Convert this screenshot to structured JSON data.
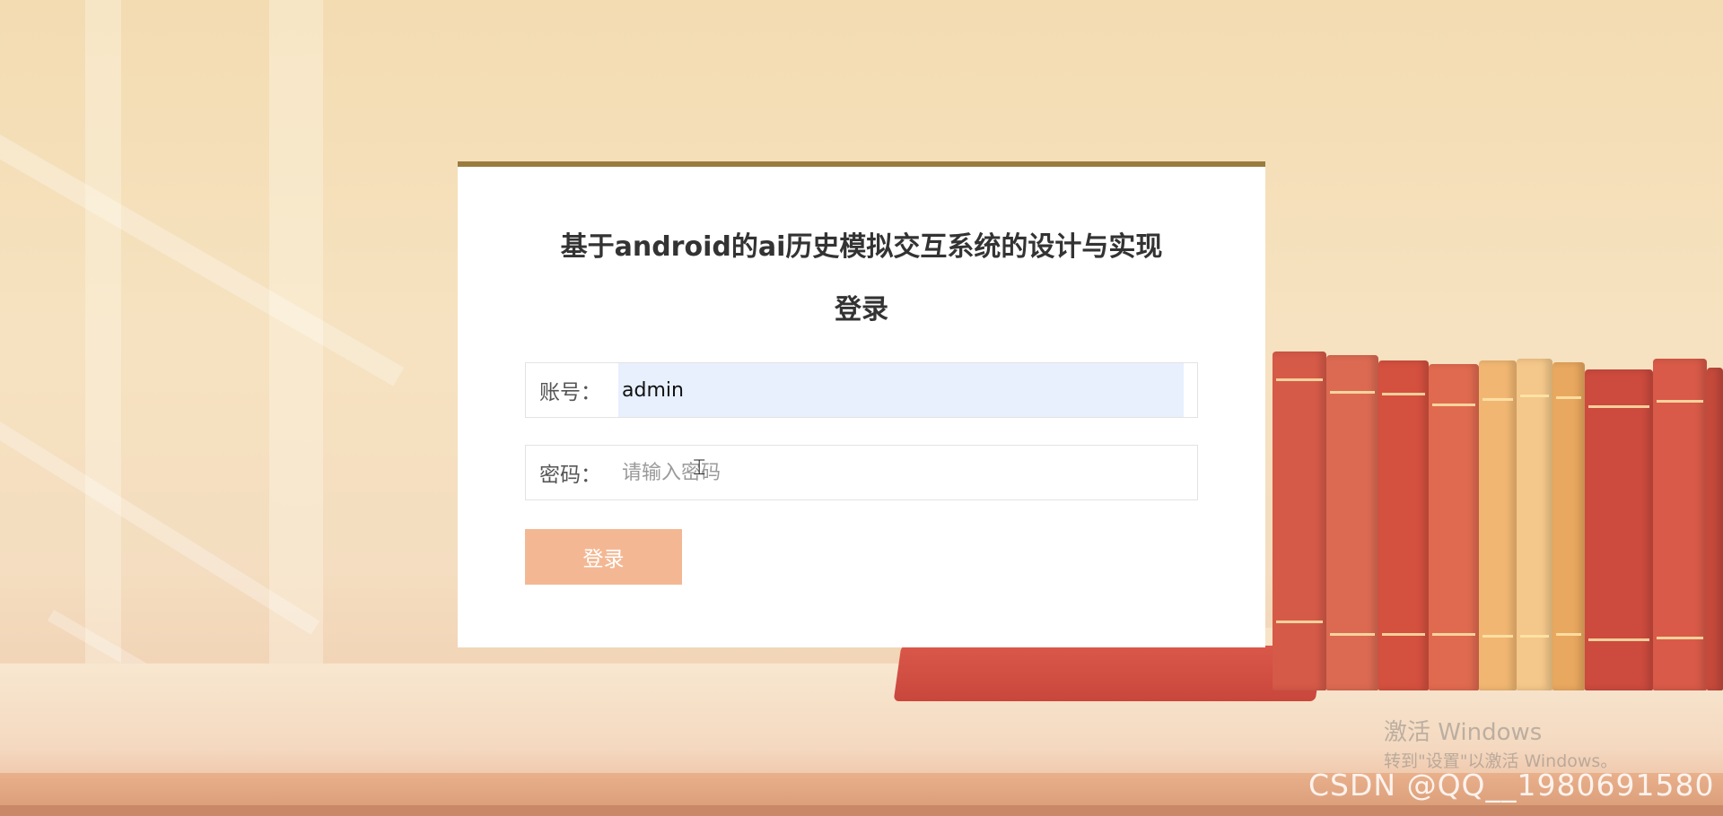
{
  "login": {
    "title": "基于android的ai历史模拟交互系统的设计与实现",
    "subtitle": "登录",
    "account_label": "账号：",
    "account_value": "admin",
    "password_label": "密码：",
    "password_placeholder": "请输入密码",
    "submit_label": "登录"
  },
  "watermark": {
    "line1": "激活 Windows",
    "line2": "转到\"设置\"以激活 Windows。",
    "csdn": "CSDN @QQ__1980691580"
  },
  "colors": {
    "card_top_border": "#9a7b3f",
    "button": "#f3b893",
    "autofill": "#e8f0fe",
    "book_red": "#d45446",
    "book_gold": "#f0b86a"
  },
  "icons": {
    "cursor": "text-cursor-icon"
  }
}
